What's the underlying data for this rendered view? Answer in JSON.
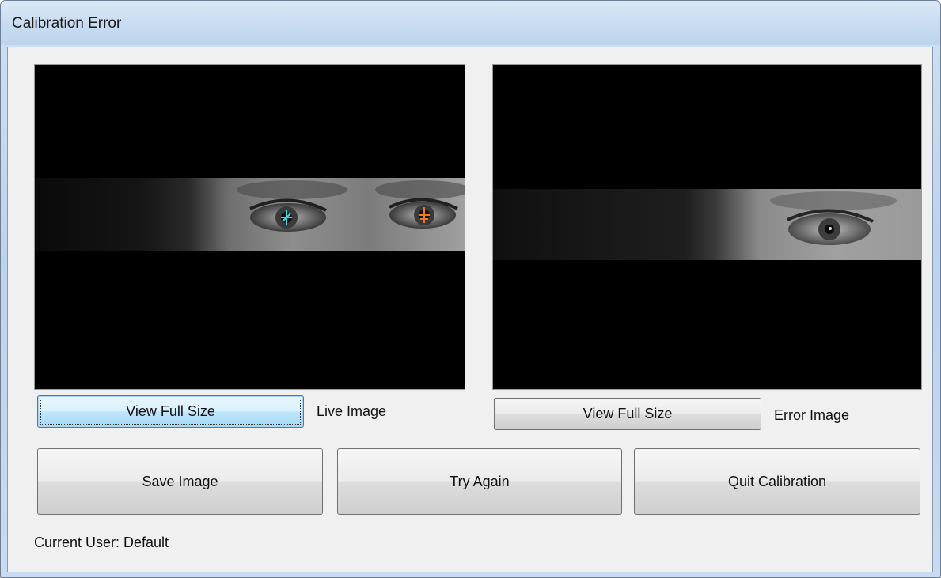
{
  "window": {
    "title": "Calibration Error"
  },
  "live_panel": {
    "caption": "Live Image",
    "view_button_label": "View Full Size"
  },
  "error_panel": {
    "caption": "Error Image",
    "view_button_label": "View Full Size"
  },
  "actions": {
    "save_label": "Save Image",
    "retry_label": "Try Again",
    "quit_label": "Quit Calibration"
  },
  "status": {
    "current_user": "Current User: Default"
  },
  "colors": {
    "left_eye_marker": "#3fd6e0",
    "right_eye_marker": "#f07a1a"
  }
}
